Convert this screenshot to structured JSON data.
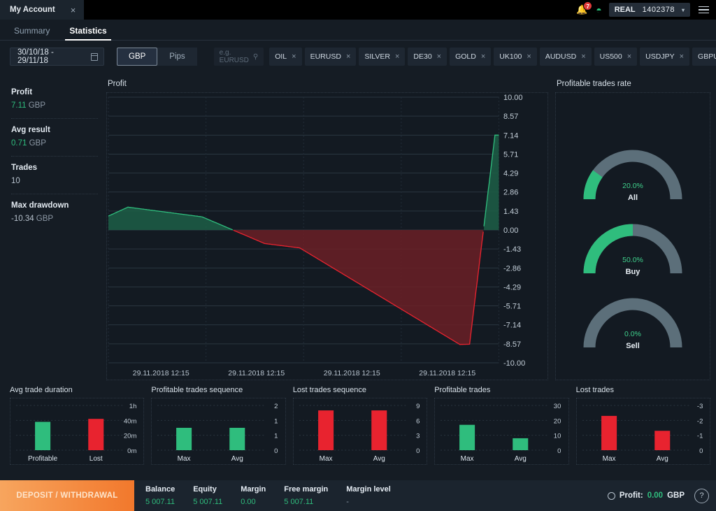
{
  "window": {
    "account_tab": "My Account",
    "close_icon": "close-icon"
  },
  "header": {
    "notification_count": "7",
    "bell_icon": "bell-icon",
    "wifi_icon": "wifi-icon",
    "account_type": "REAL",
    "account_number": "1402378",
    "chevron": "▾",
    "menu_icon": "hamburger-menu-icon"
  },
  "tabs": [
    {
      "label": "Summary",
      "active": false
    },
    {
      "label": "Statistics",
      "active": true
    }
  ],
  "filters": {
    "date_range": "30/10/18 - 29/11/18",
    "calendar_icon": "calendar-icon",
    "unit_options": [
      {
        "label": "GBP",
        "selected": true
      },
      {
        "label": "Pips",
        "selected": false
      }
    ],
    "search_placeholder": "e.g. EURUSD",
    "search_icon": "search-icon",
    "instruments": [
      "OIL",
      "EURUSD",
      "SILVER",
      "DE30",
      "GOLD",
      "UK100",
      "AUDUSD",
      "US500",
      "USDJPY",
      "GBPUSD"
    ]
  },
  "stats": [
    {
      "label": "Profit",
      "value": "7.11",
      "unit": "GBP",
      "positive": true
    },
    {
      "label": "Avg result",
      "value": "0.71",
      "unit": "GBP",
      "positive": true
    },
    {
      "label": "Trades",
      "value": "10",
      "unit": "",
      "positive": false
    },
    {
      "label": "Max drawdown",
      "value": "-10.34",
      "unit": "GBP",
      "positive": false
    }
  ],
  "panels": {
    "profit_title": "Profit",
    "rate_title": "Profitable trades rate"
  },
  "gauges": [
    {
      "name": "All",
      "percent": "20.0%",
      "value": 20.0
    },
    {
      "name": "Buy",
      "percent": "50.0%",
      "value": 50.0
    },
    {
      "name": "Sell",
      "percent": "0.0%",
      "value": 0.0
    }
  ],
  "colors": {
    "green": "#2fbd7d",
    "red": "#e8232f",
    "gauge_track": "#5c6f7a",
    "accent_orange": "#f2782c",
    "panel_bg": "#131a22"
  },
  "chart_data": [
    {
      "id": "profit-chart",
      "type": "area",
      "title": "Profit",
      "xlabel": "",
      "ylabel": "",
      "ylim": [
        -10.0,
        10.0
      ],
      "yticks": [
        "10.00",
        "8.57",
        "7.14",
        "5.71",
        "4.29",
        "2.86",
        "1.43",
        "0.00",
        "-1.43",
        "-2.86",
        "-4.29",
        "-5.71",
        "-7.14",
        "-8.57",
        "-10.00"
      ],
      "xticks": [
        "29.11.2018 12:15",
        "29.11.2018 12:15",
        "29.11.2018 12:15",
        "29.11.2018 12:15"
      ],
      "grid": true,
      "points": [
        {
          "x": 0.0,
          "y": 1.05
        },
        {
          "x": 0.05,
          "y": 1.72
        },
        {
          "x": 0.24,
          "y": 0.99
        },
        {
          "x": 0.4,
          "y": -1.02
        },
        {
          "x": 0.49,
          "y": -1.35
        },
        {
          "x": 0.9,
          "y": -8.62
        },
        {
          "x": 0.925,
          "y": -8.6
        },
        {
          "x": 0.99,
          "y": 7.14
        }
      ],
      "positive_color": "#2fbd7d",
      "negative_color": "#e8232f"
    },
    {
      "id": "avg-trade-duration",
      "type": "bar",
      "title": "Avg trade duration",
      "categories": [
        "Profitable",
        "Lost"
      ],
      "values": [
        38,
        42
      ],
      "ylim": [
        0,
        60
      ],
      "yticks": [
        "1h",
        "40m",
        "20m",
        "0m"
      ],
      "bar_colors": [
        "#2fbd7d",
        "#e8232f"
      ]
    },
    {
      "id": "profitable-trades-sequence",
      "type": "bar",
      "title": "Profitable trades sequence",
      "categories": [
        "Max",
        "Avg"
      ],
      "values": [
        1.0,
        1.0
      ],
      "ylim": [
        0,
        2
      ],
      "yticks": [
        "2",
        "1",
        "1",
        "0"
      ],
      "bar_colors": [
        "#2fbd7d",
        "#2fbd7d"
      ]
    },
    {
      "id": "lost-trades-sequence",
      "type": "bar",
      "title": "Lost trades sequence",
      "categories": [
        "Max",
        "Avg"
      ],
      "values": [
        8.0,
        8.0
      ],
      "ylim": [
        0,
        9
      ],
      "yticks": [
        "9",
        "6",
        "3",
        "0"
      ],
      "bar_colors": [
        "#e8232f",
        "#e8232f"
      ]
    },
    {
      "id": "profitable-trades",
      "type": "bar",
      "title": "Profitable trades",
      "categories": [
        "Max",
        "Avg"
      ],
      "values": [
        17.0,
        8.0
      ],
      "ylim": [
        0,
        30
      ],
      "yticks": [
        "30",
        "20",
        "10",
        "0"
      ],
      "bar_colors": [
        "#2fbd7d",
        "#2fbd7d"
      ]
    },
    {
      "id": "lost-trades",
      "type": "bar",
      "title": "Lost trades",
      "categories": [
        "Max",
        "Avg"
      ],
      "values": [
        2.3,
        1.3
      ],
      "ylim": [
        0,
        3
      ],
      "yticks": [
        "-3",
        "-2",
        "-1",
        "0"
      ],
      "bar_colors": [
        "#e8232f",
        "#e8232f"
      ]
    }
  ],
  "status_bar": {
    "deposit_label": "DEPOSIT / WITHDRAWAL",
    "cells": [
      {
        "label": "Balance",
        "value": "5 007.11",
        "dim": false
      },
      {
        "label": "Equity",
        "value": "5 007.11",
        "dim": false
      },
      {
        "label": "Margin",
        "value": "0.00",
        "dim": false
      },
      {
        "label": "Free margin",
        "value": "5 007.11",
        "dim": false
      },
      {
        "label": "Margin level",
        "value": "-",
        "dim": true
      }
    ],
    "profit_label": "Profit:",
    "profit_value": "0.00",
    "profit_currency": "GBP",
    "clock_icon": "clock-icon",
    "help_icon": "help-icon",
    "help_label": "?"
  }
}
